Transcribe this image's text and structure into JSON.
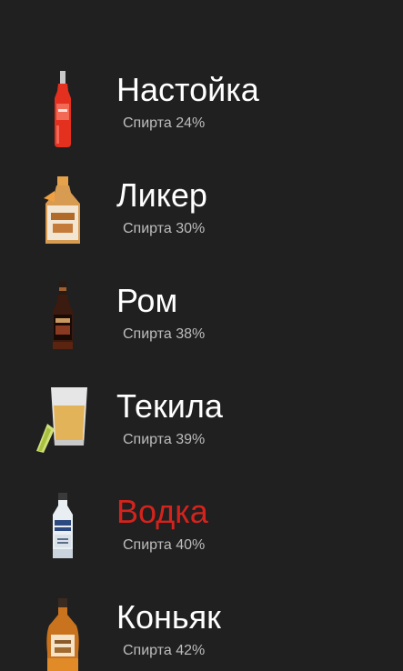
{
  "colors": {
    "background": "#202020",
    "title": "#ffffff",
    "title_selected": "#d4231c",
    "subtitle": "#bdbdbd"
  },
  "items": [
    {
      "name": "Настойка",
      "subtitle": "Спирта 24%",
      "icon": "red-vodka-bottle-icon",
      "selected": false
    },
    {
      "name": "Ликер",
      "subtitle": "Спирта 30%",
      "icon": "orange-liqueur-bottle-icon",
      "selected": false
    },
    {
      "name": "Ром",
      "subtitle": "Спирта 38%",
      "icon": "rum-bottle-icon",
      "selected": false
    },
    {
      "name": "Текила",
      "subtitle": "Спирта 39%",
      "icon": "tequila-shot-lime-icon",
      "selected": false
    },
    {
      "name": "Водка",
      "subtitle": "Спирта 40%",
      "icon": "vodka-bottle-icon",
      "selected": true
    },
    {
      "name": "Коньяк",
      "subtitle": "Спирта 42%",
      "icon": "cognac-bottle-icon",
      "selected": false
    }
  ]
}
